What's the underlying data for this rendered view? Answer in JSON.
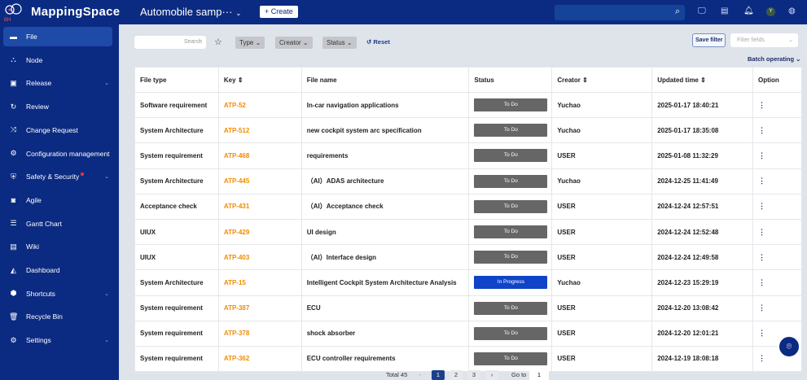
{
  "header": {
    "brand": "MappingSpace",
    "logo_text": "BH",
    "project": "Automobile samp···",
    "create_label": "+ Create",
    "avatar_initial": "Y"
  },
  "sidebar": {
    "items": [
      {
        "label": "File",
        "icon": "folder-icon",
        "glyph": "▬",
        "active": true
      },
      {
        "label": "Node",
        "icon": "node-icon",
        "glyph": "⛬"
      },
      {
        "label": "Release",
        "icon": "release-icon",
        "glyph": "▣",
        "chevron": true
      },
      {
        "label": "Review",
        "icon": "review-icon",
        "glyph": "↻"
      },
      {
        "label": "Change Request",
        "icon": "shuffle-icon",
        "glyph": "⤨"
      },
      {
        "label": "Configuration management",
        "icon": "gear-icon",
        "glyph": "⚙"
      },
      {
        "label": "Safety & Security",
        "icon": "shield-icon",
        "glyph": "⛨",
        "chevron": true,
        "dot": true
      },
      {
        "label": "Agile",
        "icon": "agile-icon",
        "glyph": "◙"
      },
      {
        "label": "Gantt Chart",
        "icon": "gantt-icon",
        "glyph": "☰"
      },
      {
        "label": "Wiki",
        "icon": "wiki-icon",
        "glyph": "▤"
      },
      {
        "label": "Dashboard",
        "icon": "dashboard-icon",
        "glyph": "◭"
      },
      {
        "label": "Shortcuts",
        "icon": "shortcuts-icon",
        "glyph": "⬢",
        "chevron": true
      },
      {
        "label": "Recycle Bin",
        "icon": "trash-icon",
        "glyph": "🗑"
      },
      {
        "label": "Settings",
        "icon": "settings-icon",
        "glyph": "⚙",
        "chevron": true
      }
    ]
  },
  "toolbar": {
    "search_placeholder": "Search",
    "type": "Type",
    "creator": "Creator",
    "status": "Status",
    "reset": "Reset",
    "save_filter": "Save filter",
    "filter_fields": "Filter fields",
    "batch": "Batch operating"
  },
  "table": {
    "headers": [
      "File type",
      "Key",
      "File name",
      "Status",
      "Creator",
      "Updated time",
      "Option"
    ],
    "rows": [
      [
        "Software requirement",
        "ATP-52",
        "In-car navigation applications",
        "To Do",
        "Yuchao",
        "2025-01-17 18:40:21"
      ],
      [
        "System Architecture",
        "ATP-512",
        "new cockpit system arc specification",
        "To Do",
        "Yuchao",
        "2025-01-17 18:35:08"
      ],
      [
        "System requirement",
        "ATP-468",
        "requirements",
        "To Do",
        "USER",
        "2025-01-08 11:32:29"
      ],
      [
        "System Architecture",
        "ATP-445",
        "（AI）ADAS architecture",
        "To Do",
        "Yuchao",
        "2024-12-25 11:41:49"
      ],
      [
        "Acceptance check",
        "ATP-431",
        "（AI）Acceptance check",
        "To Do",
        "USER",
        "2024-12-24 12:57:51"
      ],
      [
        "UIUX",
        "ATP-429",
        "UI design",
        "To Do",
        "USER",
        "2024-12-24 12:52:48"
      ],
      [
        "UIUX",
        "ATP-403",
        "（AI）Interface design",
        "To Do",
        "USER",
        "2024-12-24 12:49:58"
      ],
      [
        "System Architecture",
        "ATP-15",
        "Intelligent Cockpit System Architecture Analysis",
        "In Progress",
        "Yuchao",
        "2024-12-23 15:29:19"
      ],
      [
        "System requirement",
        "ATP-387",
        "ECU",
        "To Do",
        "USER",
        "2024-12-20 13:08:42"
      ],
      [
        "System requirement",
        "ATP-378",
        "shock absorber",
        "To Do",
        "USER",
        "2024-12-20 12:01:21"
      ],
      [
        "System requirement",
        "ATP-362",
        "ECU controller requirements",
        "To Do",
        "USER",
        "2024-12-19 18:08:18"
      ]
    ]
  },
  "pagination": {
    "total": "Total 45",
    "pages": [
      "1",
      "2",
      "3"
    ],
    "current": "1",
    "goto_label": "Go to",
    "goto_value": "1"
  },
  "colors": {
    "nav": "#0b2b82",
    "key": "#f08c00",
    "todo": "#666666",
    "progress": "#1044c8"
  }
}
